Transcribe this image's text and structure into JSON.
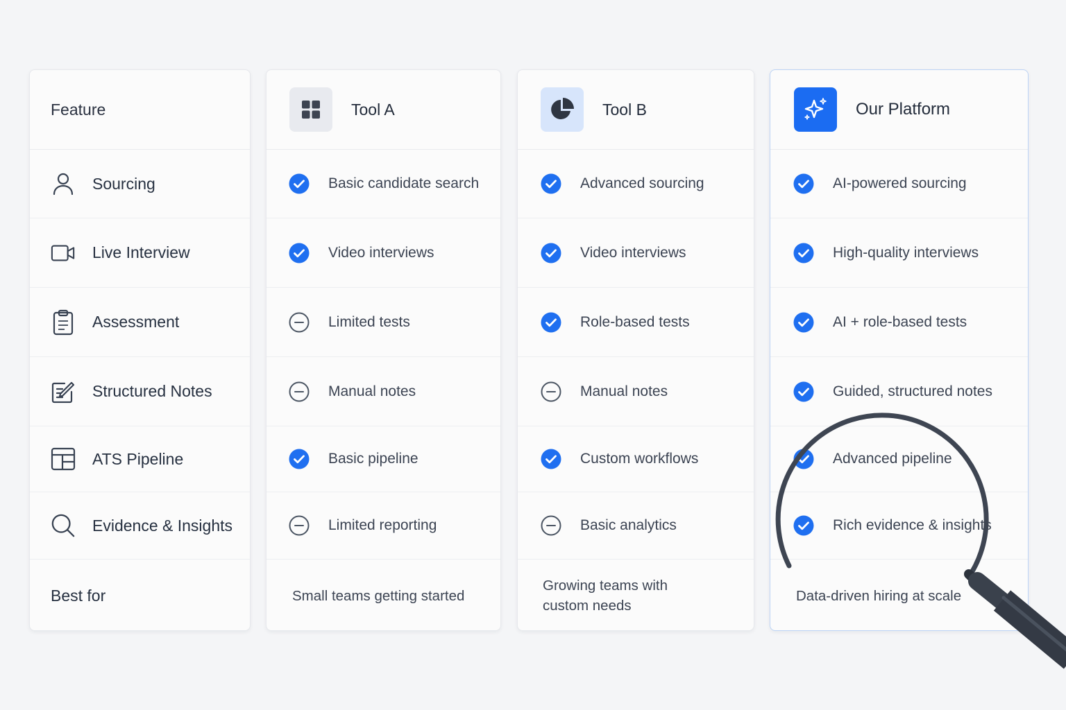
{
  "feature_column": {
    "header": "Feature",
    "rows": [
      {
        "label": "Sourcing",
        "icon": "person-icon"
      },
      {
        "label": "Live Interview",
        "icon": "video-camera-icon"
      },
      {
        "label": "Assessment",
        "icon": "clipboard-icon"
      },
      {
        "label": "Structured Notes",
        "icon": "edit-note-icon"
      },
      {
        "label": "ATS Pipeline",
        "icon": "pipeline-board-icon"
      },
      {
        "label": "Evidence & Insights",
        "icon": "search-icon"
      }
    ],
    "best_for": "Best for"
  },
  "tools": [
    {
      "name": "Tool A",
      "icon": "grid-icon",
      "rows": [
        {
          "status": "check",
          "text": "Basic candidate search"
        },
        {
          "status": "check",
          "text": "Video interviews"
        },
        {
          "status": "partial",
          "text": "Limited tests"
        },
        {
          "status": "partial",
          "text": "Manual notes"
        },
        {
          "status": "check",
          "text": "Basic pipeline"
        },
        {
          "status": "partial",
          "text": "Limited reporting"
        }
      ],
      "best_for": "Small teams getting started"
    },
    {
      "name": "Tool B",
      "icon": "pie-chart-icon",
      "rows": [
        {
          "status": "check",
          "text": "Advanced sourcing"
        },
        {
          "status": "check",
          "text": "Video interviews"
        },
        {
          "status": "check",
          "text": "Role-based tests"
        },
        {
          "status": "partial",
          "text": "Manual notes"
        },
        {
          "status": "check",
          "text": "Custom workflows"
        },
        {
          "status": "partial",
          "text": "Basic analytics"
        }
      ],
      "best_for": "Growing teams with custom needs"
    },
    {
      "name": "Our Platform",
      "icon": "sparkle-icon",
      "rows": [
        {
          "status": "check",
          "text": "AI-powered sourcing"
        },
        {
          "status": "check",
          "text": "High-quality interviews"
        },
        {
          "status": "check",
          "text": "AI + role-based tests"
        },
        {
          "status": "check",
          "text": "Guided, structured notes"
        },
        {
          "status": "check",
          "text": "Advanced pipeline"
        },
        {
          "status": "check",
          "text": "Rich evidence & insights"
        }
      ],
      "best_for": "Data-driven hiring at scale"
    }
  ],
  "colors": {
    "accent": "#1b6cf2",
    "check": "#1f6ff0",
    "partial": "#4b5563",
    "highlight_border": "#bcd3f5"
  },
  "overlay_icon": "magnifying-glass-icon"
}
